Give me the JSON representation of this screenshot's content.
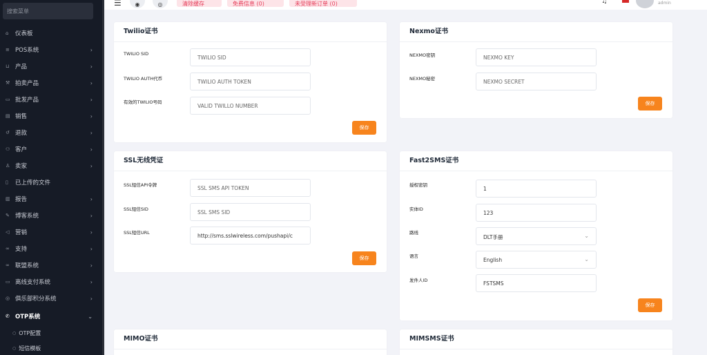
{
  "sidebar": {
    "search_placeholder": "搜索菜单",
    "items": [
      {
        "label": "仪表板",
        "icon": "home-icon",
        "chevron": ""
      },
      {
        "label": "POS系统",
        "icon": "list-icon",
        "chevron": "›"
      },
      {
        "label": "产品",
        "icon": "cart-icon",
        "chevron": "›"
      },
      {
        "label": "拍卖产品",
        "icon": "gavel-icon",
        "chevron": "›"
      },
      {
        "label": "批发产品",
        "icon": "box-icon",
        "chevron": "›"
      },
      {
        "label": "销售",
        "icon": "money-icon",
        "chevron": "›"
      },
      {
        "label": "退款",
        "icon": "refund-icon",
        "chevron": "›"
      },
      {
        "label": "客户",
        "icon": "users-icon",
        "chevron": "›"
      },
      {
        "label": "卖家",
        "icon": "user-icon",
        "chevron": "›"
      },
      {
        "label": "已上传的文件",
        "icon": "file-icon",
        "chevron": ""
      },
      {
        "label": "报告",
        "icon": "report-icon",
        "chevron": "›"
      },
      {
        "label": "博客系统",
        "icon": "blog-icon",
        "chevron": "›"
      },
      {
        "label": "营销",
        "icon": "megaphone-icon",
        "chevron": "›"
      },
      {
        "label": "支持",
        "icon": "link-icon",
        "chevron": "›"
      },
      {
        "label": "联盟系统",
        "icon": "link-icon",
        "chevron": "›"
      },
      {
        "label": "离线支付系统",
        "icon": "card-icon",
        "chevron": "›"
      },
      {
        "label": "俱乐部积分系统",
        "icon": "coin-icon",
        "chevron": "›"
      },
      {
        "label": "OTP系统",
        "icon": "phone-icon",
        "chevron": "⌄"
      }
    ],
    "sub_items": [
      {
        "label": "OTP配置"
      },
      {
        "label": "短信模板"
      }
    ]
  },
  "topbar": {
    "buttons": [
      "清除缓存",
      "免费信息 (0)",
      "未受理新订单 (0)"
    ],
    "username": "admin"
  },
  "cards": {
    "twilio": {
      "title": "Twilio证书",
      "fields": [
        {
          "label": "TWILIO SID",
          "placeholder": "TWILIO SID"
        },
        {
          "label": "TWILIO AUTH代币",
          "placeholder": "TWILIO AUTH TOKEN"
        },
        {
          "label": "有效的TWILIO号码",
          "placeholder": "VALID TWILLO NUMBER"
        }
      ],
      "save": "保存"
    },
    "nexmo": {
      "title": "Nexmo证书",
      "fields": [
        {
          "label": "NEXMO密钥",
          "placeholder": "NEXMO KEY"
        },
        {
          "label": "NEXMO秘密",
          "placeholder": "NEXMO SECRET"
        }
      ],
      "save": "保存"
    },
    "ssl": {
      "title": "SSL无线凭证",
      "fields": [
        {
          "label": "SSL短信API令牌",
          "placeholder": "SSL SMS API TOKEN"
        },
        {
          "label": "SSL短信SID",
          "placeholder": "SSL SMS SID"
        },
        {
          "label": "SSL短信URL",
          "value": "http://sms.sslwireless.com/pushapi/c"
        }
      ],
      "save": "保存"
    },
    "fast2sms": {
      "title": "Fast2SMS证书",
      "fields": [
        {
          "label": "授权密钥",
          "value": "1"
        },
        {
          "label": "实体ID",
          "value": "123"
        },
        {
          "label": "路线",
          "value": "DLT手册"
        },
        {
          "label": "语言",
          "value": "English"
        },
        {
          "label": "发件人ID",
          "value": "FSTSMS"
        }
      ],
      "save": "保存"
    },
    "mimo": {
      "title": "MIMO证书"
    },
    "mimsms": {
      "title": "MIMSMS证书"
    }
  },
  "colors": {
    "sidebar_bg": "#161b26",
    "accent": "#f7841d",
    "topbar_button_bg": "#fde4e8",
    "topbar_button_text": "#e53e5a"
  }
}
